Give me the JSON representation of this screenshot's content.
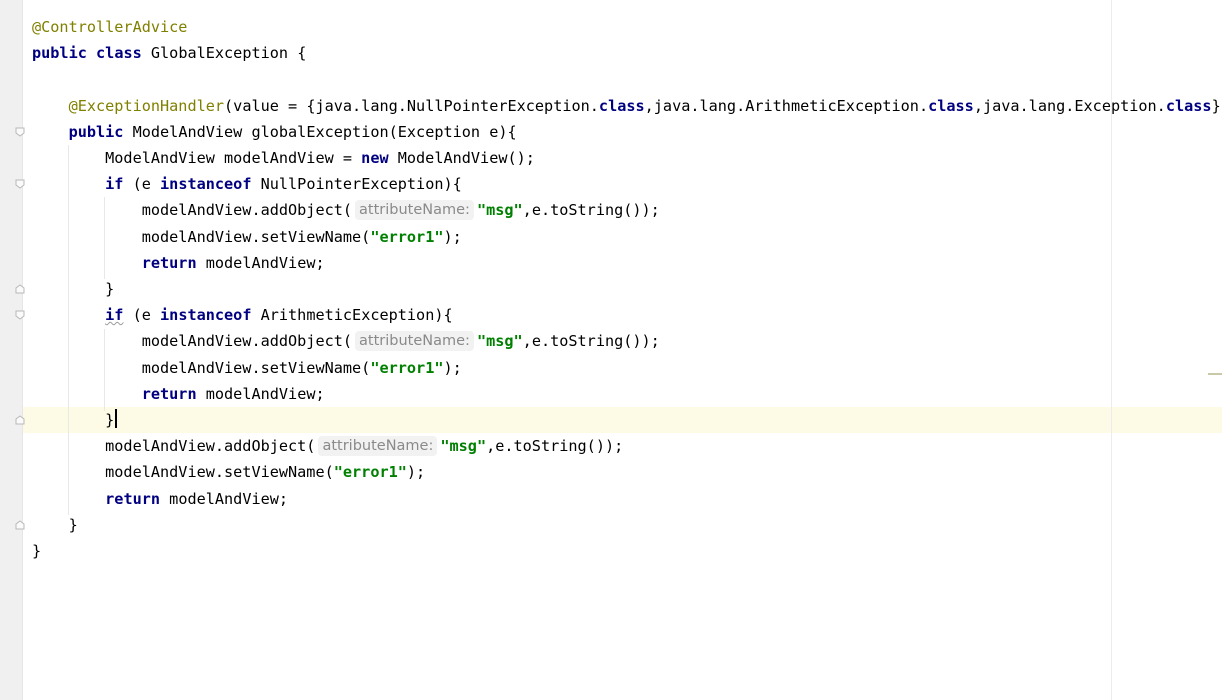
{
  "editor": {
    "lines": [
      {
        "id": "l1",
        "parts": [
          {
            "cls": "ann",
            "t": "@ControllerAdvice"
          }
        ]
      },
      {
        "id": "l2",
        "parts": [
          {
            "cls": "kw",
            "t": "public"
          },
          {
            "t": " "
          },
          {
            "cls": "kw",
            "t": "class"
          },
          {
            "t": " GlobalException {"
          }
        ]
      },
      {
        "id": "l3",
        "parts": []
      },
      {
        "id": "l4",
        "parts": [
          {
            "t": "    "
          },
          {
            "cls": "ann",
            "t": "@ExceptionHandler"
          },
          {
            "t": "(value = {java.lang.NullPointerException."
          },
          {
            "cls": "kw",
            "t": "class"
          },
          {
            "t": ",java.lang.ArithmeticException."
          },
          {
            "cls": "kw",
            "t": "class"
          },
          {
            "t": ",java.lang.Exception."
          },
          {
            "cls": "kw",
            "t": "class"
          },
          {
            "t": "})"
          }
        ]
      },
      {
        "id": "l5",
        "parts": [
          {
            "t": "    "
          },
          {
            "cls": "kw",
            "t": "public"
          },
          {
            "t": " ModelAndView globalException(Exception e){"
          }
        ]
      },
      {
        "id": "l6",
        "parts": [
          {
            "t": "        ModelAndView modelAndView = "
          },
          {
            "cls": "kw",
            "t": "new"
          },
          {
            "t": " ModelAndView();"
          }
        ]
      },
      {
        "id": "l7",
        "parts": [
          {
            "t": "        "
          },
          {
            "cls": "kw",
            "t": "if"
          },
          {
            "t": " (e "
          },
          {
            "cls": "kw",
            "t": "instanceof"
          },
          {
            "t": " NullPointerException){"
          }
        ]
      },
      {
        "id": "l8",
        "parts": [
          {
            "t": "            modelAndView.addObject("
          },
          {
            "cls": "hint",
            "t": "attributeName:"
          },
          {
            "cls": "str",
            "t": "\"msg\""
          },
          {
            "t": ",e.toString());"
          }
        ]
      },
      {
        "id": "l9",
        "parts": [
          {
            "t": "            modelAndView.setViewName("
          },
          {
            "cls": "str",
            "t": "\"error1\""
          },
          {
            "t": ");"
          }
        ]
      },
      {
        "id": "l10",
        "parts": [
          {
            "t": "            "
          },
          {
            "cls": "kw",
            "t": "return"
          },
          {
            "t": " modelAndView;"
          }
        ]
      },
      {
        "id": "l11",
        "parts": [
          {
            "t": "        }"
          }
        ]
      },
      {
        "id": "l12",
        "parts": [
          {
            "t": "        "
          },
          {
            "cls": "kw wavy",
            "t": "if"
          },
          {
            "t": " (e "
          },
          {
            "cls": "kw",
            "t": "instanceof"
          },
          {
            "t": " ArithmeticException){"
          }
        ]
      },
      {
        "id": "l13",
        "parts": [
          {
            "t": "            modelAndView.addObject("
          },
          {
            "cls": "hint",
            "t": "attributeName:"
          },
          {
            "cls": "str",
            "t": "\"msg\""
          },
          {
            "t": ",e.toString());"
          }
        ]
      },
      {
        "id": "l14",
        "parts": [
          {
            "t": "            modelAndView.setViewName("
          },
          {
            "cls": "str",
            "t": "\"error1\""
          },
          {
            "t": ");"
          }
        ]
      },
      {
        "id": "l15",
        "parts": [
          {
            "t": "            "
          },
          {
            "cls": "kw",
            "t": "return"
          },
          {
            "t": " modelAndView;"
          }
        ]
      },
      {
        "id": "l16",
        "parts": [
          {
            "t": "        }"
          },
          {
            "cls": "caret",
            "t": ""
          }
        ]
      },
      {
        "id": "l17",
        "parts": [
          {
            "t": "        modelAndView.addObject("
          },
          {
            "cls": "hint",
            "t": "attributeName:"
          },
          {
            "cls": "str",
            "t": "\"msg\""
          },
          {
            "t": ",e.toString());"
          }
        ]
      },
      {
        "id": "l18",
        "parts": [
          {
            "t": "        modelAndView.setViewName("
          },
          {
            "cls": "str",
            "t": "\"error1\""
          },
          {
            "t": ");"
          }
        ]
      },
      {
        "id": "l19",
        "parts": [
          {
            "t": "        "
          },
          {
            "cls": "kw",
            "t": "return"
          },
          {
            "t": " modelAndView;"
          }
        ]
      },
      {
        "id": "l20",
        "parts": [
          {
            "t": "    }"
          }
        ]
      },
      {
        "id": "l21",
        "parts": [
          {
            "t": "}"
          }
        ]
      }
    ],
    "current_line": 16,
    "fold_markers": [
      {
        "line": 5,
        "kind": "open"
      },
      {
        "line": 7,
        "kind": "open"
      },
      {
        "line": 11,
        "kind": "close"
      },
      {
        "line": 12,
        "kind": "open"
      },
      {
        "line": 16,
        "kind": "close"
      },
      {
        "line": 20,
        "kind": "close"
      }
    ],
    "colors": {
      "keyword": "#000080",
      "annotation": "#808000",
      "string": "#008000",
      "hint": "#8a8a8a",
      "current_line_bg": "#fdfbe6"
    }
  }
}
